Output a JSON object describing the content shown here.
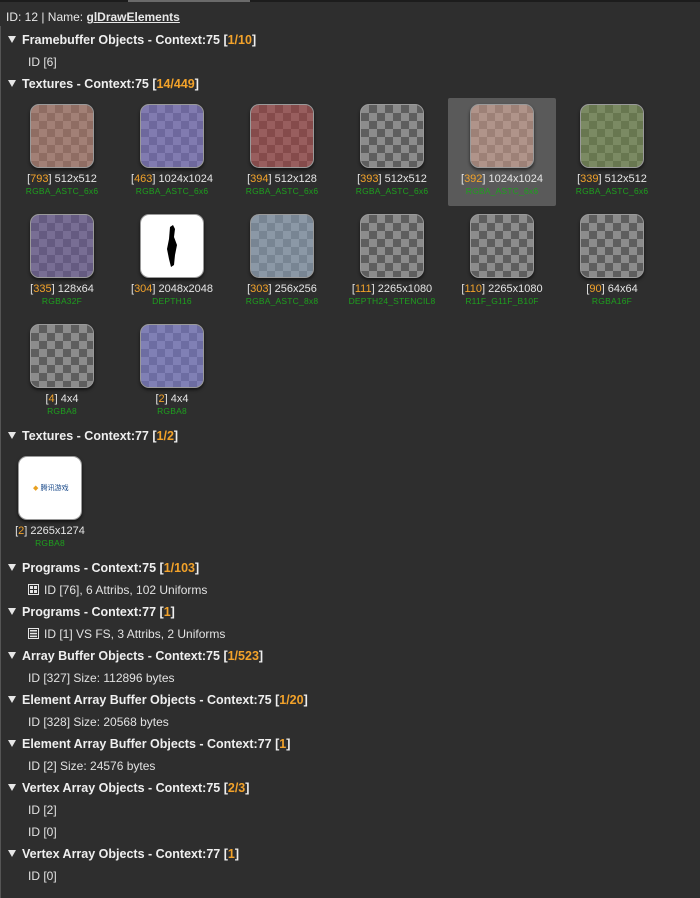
{
  "title": {
    "id_label": "ID: 12 | Name: ",
    "name": "glDrawElements"
  },
  "sections": {
    "fbo75": {
      "label": "Framebuffer Objects - Context:75 ",
      "count": "1/10",
      "items": [
        "ID [6]"
      ]
    },
    "tex75": {
      "label": "Textures - Context:75 ",
      "count": "14/449",
      "textures": [
        {
          "id": "793",
          "size": "512x512",
          "format": "RGBA_ASTC_6x6",
          "tint": "#b07868"
        },
        {
          "id": "463",
          "size": "1024x1024",
          "format": "RGBA_ASTC_6x6",
          "tint": "#7a70c8"
        },
        {
          "id": "394",
          "size": "512x128",
          "format": "RGBA_ASTC_6x6",
          "tint": "#a04040"
        },
        {
          "id": "393",
          "size": "512x512",
          "format": "RGBA_ASTC_6x6",
          "tint": "none"
        },
        {
          "id": "392",
          "size": "1024x1024",
          "format": "RGBA_ASTC_6x6",
          "tint": "#c89a88"
        },
        {
          "id": "339",
          "size": "512x512",
          "format": "RGBA_ASTC_6x6",
          "tint": "#708848"
        },
        {
          "id": "335",
          "size": "128x64",
          "format": "RGBA32F",
          "tint": "#6a5a9a"
        },
        {
          "id": "304",
          "size": "2048x2048",
          "format": "DEPTH16",
          "tint": "#ffffff"
        },
        {
          "id": "303",
          "size": "256x256",
          "format": "RGBA_ASTC_8x8",
          "tint": "#8aa0b8"
        },
        {
          "id": "111",
          "size": "2265x1080",
          "format": "DEPTH24_STENCIL8",
          "tint": "none"
        },
        {
          "id": "110",
          "size": "2265x1080",
          "format": "R11F_G11F_B10F",
          "tint": "none"
        },
        {
          "id": "90",
          "size": "64x64",
          "format": "RGBA16F",
          "tint": "none"
        },
        {
          "id": "4",
          "size": "4x4",
          "format": "RGBA8",
          "tint": "none"
        },
        {
          "id": "2",
          "size": "4x4",
          "format": "RGBA8",
          "tint": "#7878d0"
        }
      ]
    },
    "tex77": {
      "label": "Textures - Context:77 ",
      "count": "1/2",
      "textures": [
        {
          "id": "2",
          "size": "2265x1274",
          "format": "RGBA8",
          "tint": "#ffffff",
          "logo_text": "腾讯游戏"
        }
      ]
    },
    "prog75": {
      "label": "Programs - Context:75 ",
      "count": "1/103",
      "items": [
        "ID [76], 6 Attribs, 102 Uniforms"
      ]
    },
    "prog77": {
      "label": "Programs - Context:77 ",
      "count": "1",
      "items": [
        "ID [1] VS FS, 3 Attribs, 2 Uniforms"
      ]
    },
    "abo75": {
      "label": "Array Buffer Objects - Context:75 ",
      "count": "1/523",
      "items": [
        "ID [327] Size: 112896 bytes"
      ]
    },
    "eabo75": {
      "label": "Element Array Buffer Objects - Context:75 ",
      "count": "1/20",
      "items": [
        "ID [328] Size: 20568 bytes"
      ]
    },
    "eabo77": {
      "label": "Element Array Buffer Objects - Context:77 ",
      "count": "1",
      "items": [
        "ID [2] Size: 24576 bytes"
      ]
    },
    "vao75": {
      "label": "Vertex Array Objects - Context:75 ",
      "count": "2/3",
      "items": [
        "ID [2]",
        "ID [0]"
      ]
    },
    "vao77": {
      "label": "Vertex Array Objects - Context:77 ",
      "count": "1",
      "items": [
        "ID [0]"
      ]
    }
  },
  "colors": {
    "accent": "#f2a22a",
    "format": "#1ea01e",
    "background": "#2e2e2e"
  },
  "selected_texture_id": "392"
}
